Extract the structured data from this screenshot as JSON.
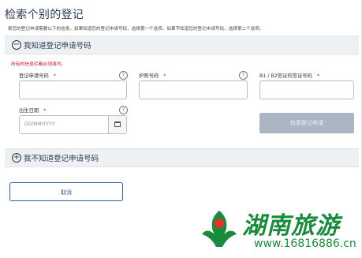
{
  "page": {
    "title": "检索个别的登记",
    "subtitle": "索您的登记申请需要以下的信息。如果知道您的登记申请号码，选择第一个选项。如果不知道您的登记申请号码，选择第二个选项。"
  },
  "section_known": {
    "icon": "minus-circle-icon",
    "icon_glyph": "−",
    "label": "我知道登记申请号码",
    "required_note": "所有的信息栏都必须填写。",
    "fields": {
      "application_number": {
        "label": "登记申请号码",
        "required": "*",
        "help": "?",
        "value": ""
      },
      "passport_number": {
        "label": "护照号码",
        "required": "*",
        "help": "?",
        "value": ""
      },
      "visa_number": {
        "label": "B1 / B2签证的签证号码",
        "required": "*",
        "value": ""
      },
      "birth_date": {
        "label": "出生日期",
        "required": "*",
        "help": "?",
        "placeholder": "DD/MM/YYYY",
        "value": ""
      }
    },
    "search_button": "检索登记申请"
  },
  "section_unknown": {
    "icon": "plus-circle-icon",
    "icon_glyph": "+",
    "label": "我不知道登记申请号码"
  },
  "cancel_button": "取消",
  "watermark": {
    "text": "湖南旅游",
    "url": "www.16816886.cn",
    "colors": {
      "brand": "#1a8a3c",
      "accent": "#e5322d"
    }
  }
}
